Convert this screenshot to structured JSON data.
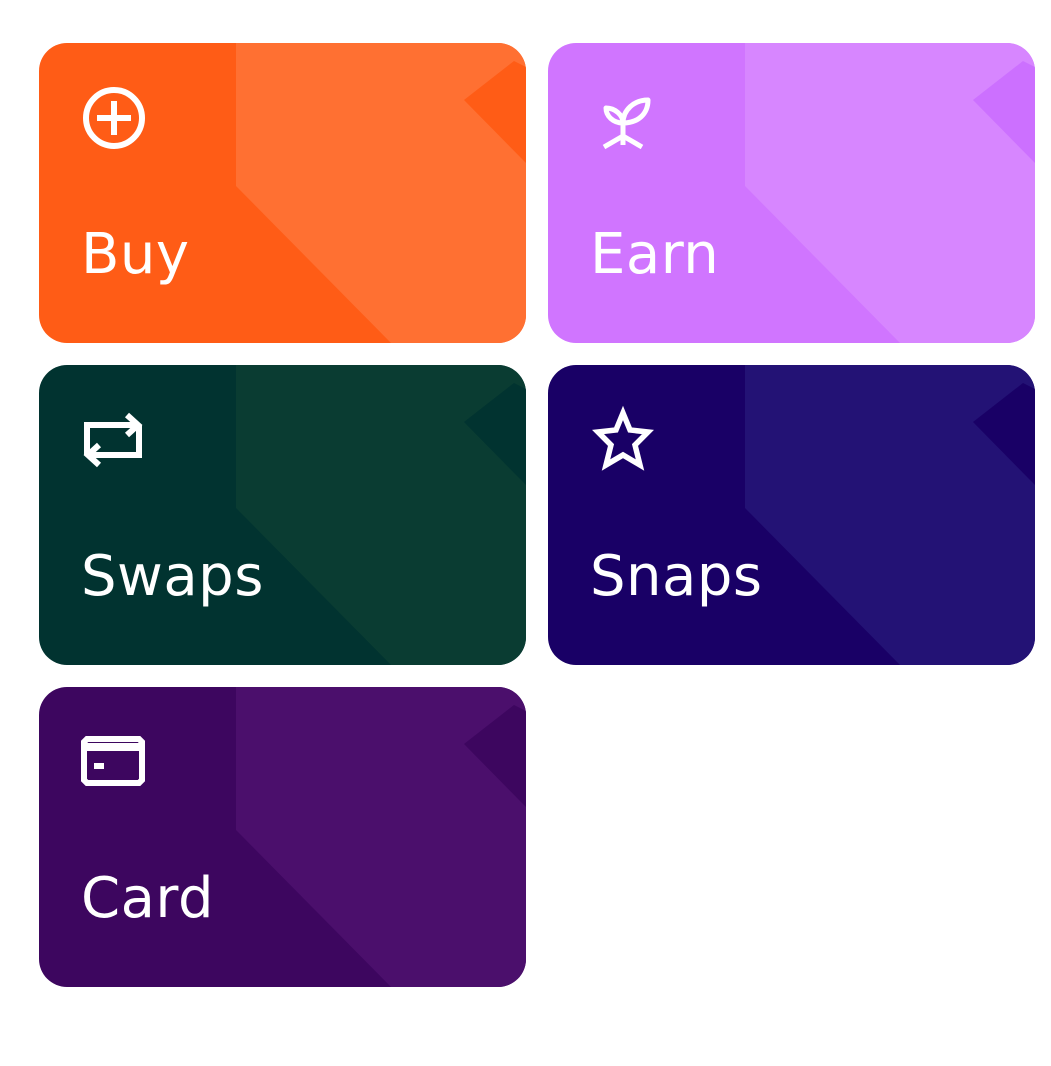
{
  "tiles": [
    {
      "id": "buy",
      "label": "Buy",
      "icon": "plus-circle-icon",
      "base": "#FF5C16",
      "light": "#FF7032",
      "dark": "#FF5C16"
    },
    {
      "id": "earn",
      "label": "Earn",
      "icon": "sprout-icon",
      "base": "#D075FF",
      "light": "#D786FF",
      "dark": "#CC70FF"
    },
    {
      "id": "swaps",
      "label": "Swaps",
      "icon": "swap-arrows-icon",
      "base": "#013330",
      "light": "#0A3C32",
      "dark": "#013330"
    },
    {
      "id": "snaps",
      "label": "Snaps",
      "icon": "star-outline-icon",
      "base": "#190066",
      "light": "#231275",
      "dark": "#190066"
    },
    {
      "id": "card",
      "label": "Card",
      "icon": "credit-card-icon",
      "base": "#3D065F",
      "light": "#4B0F6C",
      "dark": "#3D065F"
    }
  ]
}
